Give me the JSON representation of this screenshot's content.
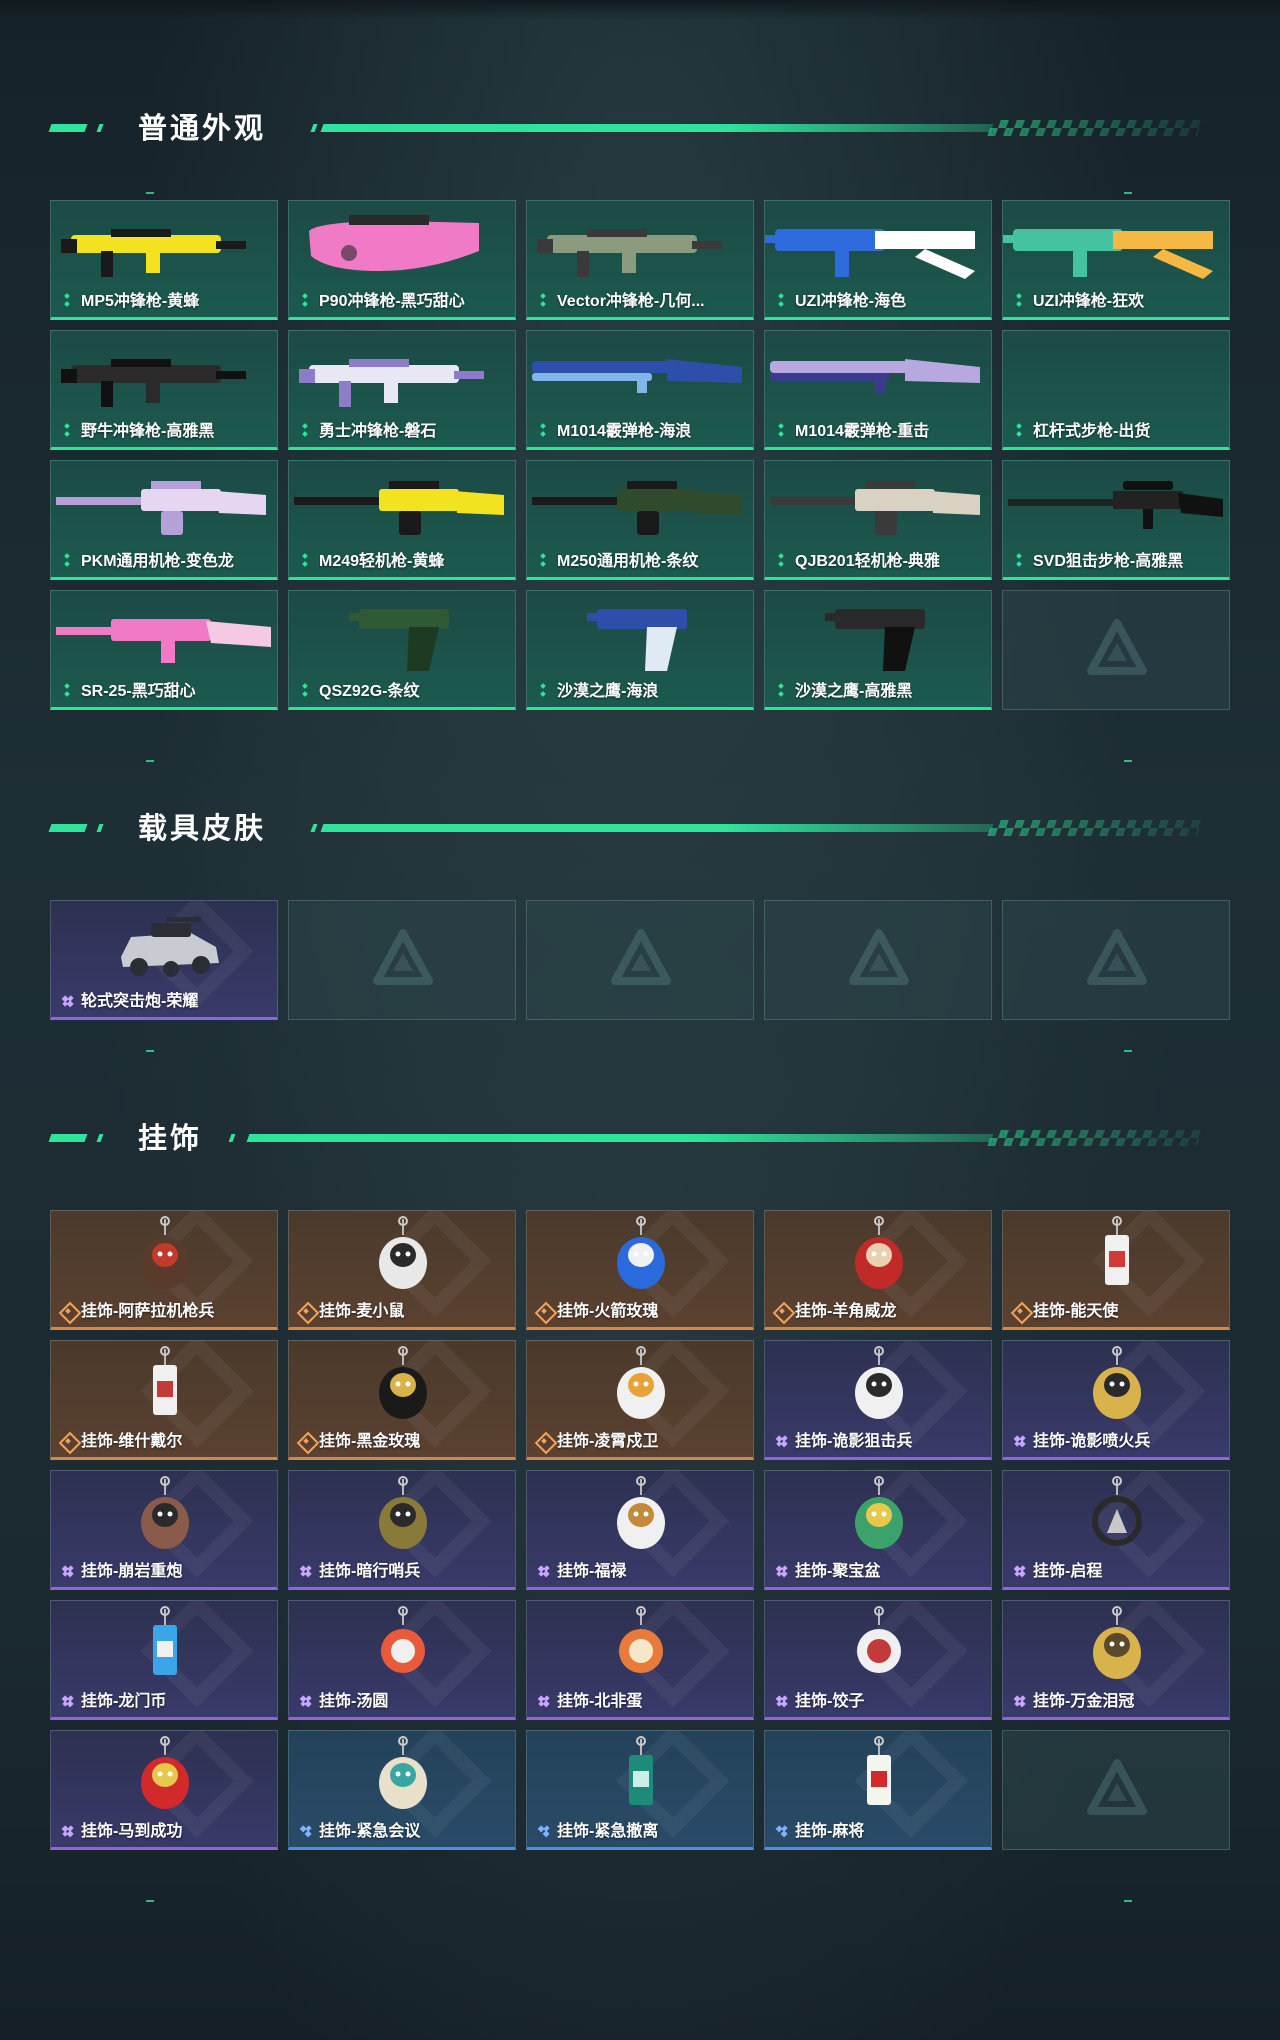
{
  "sections": [
    {
      "title": "普通外观",
      "items": [
        {
          "label": "MP5冲锋枪-黄蜂",
          "rarity": "green",
          "art": "weapon-smg",
          "colors": [
            "#f2e21f",
            "#1a1a1a"
          ]
        },
        {
          "label": "P90冲锋枪-黑巧甜心",
          "rarity": "green",
          "art": "weapon-p90",
          "colors": [
            "#f07ac6",
            "#2a2a2a"
          ]
        },
        {
          "label": "Vector冲锋枪-几何...",
          "rarity": "green",
          "art": "weapon-smg",
          "colors": [
            "#8c9a7e",
            "#3a3a3a"
          ]
        },
        {
          "label": "UZI冲锋枪-海色",
          "rarity": "green",
          "art": "weapon-uzi",
          "colors": [
            "#ffffff",
            "#2e6bdc"
          ]
        },
        {
          "label": "UZI冲锋枪-狂欢",
          "rarity": "green",
          "art": "weapon-uzi",
          "colors": [
            "#f5b943",
            "#45c2a0"
          ]
        },
        {
          "label": "野牛冲锋枪-高雅黑",
          "rarity": "green",
          "art": "weapon-smg",
          "colors": [
            "#2b2b2b",
            "#111111"
          ]
        },
        {
          "label": "勇士冲锋枪-磐石",
          "rarity": "green",
          "art": "weapon-smg",
          "colors": [
            "#e8e8f5",
            "#8e7bc9"
          ]
        },
        {
          "label": "M1014霰弹枪-海浪",
          "rarity": "green",
          "art": "weapon-shotgun",
          "colors": [
            "#2d4fa9",
            "#7fb7ea"
          ]
        },
        {
          "label": "M1014霰弹枪-重击",
          "rarity": "green",
          "art": "weapon-shotgun",
          "colors": [
            "#b7a9e0",
            "#3b3a8c"
          ]
        },
        {
          "label": "杠杆式步枪-出货",
          "rarity": "green",
          "art": "none",
          "colors": [
            "#000000",
            "#000000"
          ]
        },
        {
          "label": "PKM通用机枪-变色龙",
          "rarity": "green",
          "art": "weapon-lmg",
          "colors": [
            "#e6d6f2",
            "#b4a1d8"
          ]
        },
        {
          "label": "M249轻机枪-黄蜂",
          "rarity": "green",
          "art": "weapon-lmg",
          "colors": [
            "#f2e21f",
            "#1a1a1a"
          ]
        },
        {
          "label": "M250通用机枪-条纹",
          "rarity": "green",
          "art": "weapon-lmg",
          "colors": [
            "#2f4a2c",
            "#1a1a1a"
          ]
        },
        {
          "label": "QJB201轻机枪-典雅",
          "rarity": "green",
          "art": "weapon-lmg",
          "colors": [
            "#d9d2c2",
            "#3a3a3a"
          ]
        },
        {
          "label": "SVD狙击步枪-高雅黑",
          "rarity": "green",
          "art": "weapon-sniper",
          "colors": [
            "#222222",
            "#111111"
          ]
        },
        {
          "label": "SR-25-黑巧甜心",
          "rarity": "green",
          "art": "weapon-rifle",
          "colors": [
            "#f07ac6",
            "#f5c8e4"
          ]
        },
        {
          "label": "QSZ92G-条纹",
          "rarity": "green",
          "art": "weapon-pistol",
          "colors": [
            "#2f5a35",
            "#1d3a22"
          ]
        },
        {
          "label": "沙漠之鹰-海浪",
          "rarity": "green",
          "art": "weapon-pistol",
          "colors": [
            "#2d4fa9",
            "#dfeaf5"
          ]
        },
        {
          "label": "沙漠之鹰-高雅黑",
          "rarity": "green",
          "art": "weapon-pistol",
          "colors": [
            "#2a2a2a",
            "#111111"
          ]
        },
        {
          "label": "",
          "rarity": "empty",
          "art": "empty",
          "colors": [
            "#000000",
            "#000000"
          ]
        }
      ]
    },
    {
      "title": "载具皮肤",
      "items": [
        {
          "label": "轮式突击炮-荣耀",
          "rarity": "purple",
          "art": "vehicle",
          "colors": [
            "#c8ccd2",
            "#2a2d35"
          ]
        },
        {
          "label": "",
          "rarity": "empty",
          "art": "empty",
          "colors": [
            "#000000",
            "#000000"
          ]
        },
        {
          "label": "",
          "rarity": "empty",
          "art": "empty",
          "colors": [
            "#000000",
            "#000000"
          ]
        },
        {
          "label": "",
          "rarity": "empty",
          "art": "empty",
          "colors": [
            "#000000",
            "#000000"
          ]
        },
        {
          "label": "",
          "rarity": "empty",
          "art": "empty",
          "colors": [
            "#000000",
            "#000000"
          ]
        }
      ]
    },
    {
      "title": "挂饰",
      "items": [
        {
          "label": "挂饰-阿萨拉机枪兵",
          "rarity": "orange",
          "art": "charm",
          "colors": [
            "#5a3a2a",
            "#c23a2a"
          ]
        },
        {
          "label": "挂饰-麦小鼠",
          "rarity": "orange",
          "art": "charm",
          "colors": [
            "#e8e8e8",
            "#2a2a2a"
          ]
        },
        {
          "label": "挂饰-火箭玫瑰",
          "rarity": "orange",
          "art": "charm",
          "colors": [
            "#2a6adc",
            "#f0f0f0"
          ]
        },
        {
          "label": "挂饰-羊角威龙",
          "rarity": "orange",
          "art": "charm",
          "colors": [
            "#c22a2a",
            "#e8d0b0"
          ]
        },
        {
          "label": "挂饰-能天使",
          "rarity": "orange",
          "art": "charm-tag",
          "colors": [
            "#f0f0f0",
            "#d23a3a"
          ]
        },
        {
          "label": "挂饰-维什戴尔",
          "rarity": "orange",
          "art": "charm-tag",
          "colors": [
            "#f0f0f0",
            "#c23a3a"
          ]
        },
        {
          "label": "挂饰-黑金玫瑰",
          "rarity": "orange",
          "art": "charm",
          "colors": [
            "#1a1a1a",
            "#d8b24a"
          ]
        },
        {
          "label": "挂饰-凌霄戍卫",
          "rarity": "orange",
          "art": "charm",
          "colors": [
            "#f0f0f0",
            "#e8a23a"
          ]
        },
        {
          "label": "挂饰-诡影狙击兵",
          "rarity": "purple",
          "art": "charm",
          "colors": [
            "#f0f0f0",
            "#2a2a2a"
          ]
        },
        {
          "label": "挂饰-诡影喷火兵",
          "rarity": "purple",
          "art": "charm",
          "colors": [
            "#d8b24a",
            "#2a2a2a"
          ]
        },
        {
          "label": "挂饰-崩岩重炮",
          "rarity": "purple",
          "art": "charm",
          "colors": [
            "#8a5a4a",
            "#2a2a2a"
          ]
        },
        {
          "label": "挂饰-暗行哨兵",
          "rarity": "purple",
          "art": "charm",
          "colors": [
            "#8a7a3a",
            "#2a2a2a"
          ]
        },
        {
          "label": "挂饰-福禄",
          "rarity": "purple",
          "art": "charm",
          "colors": [
            "#f0f0f0",
            "#c28a3a"
          ]
        },
        {
          "label": "挂饰-聚宝盆",
          "rarity": "purple",
          "art": "charm",
          "colors": [
            "#3aa26a",
            "#e8c84a"
          ]
        },
        {
          "label": "挂饰-启程",
          "rarity": "purple",
          "art": "charm-ring",
          "colors": [
            "#2a2a2a",
            "#c8c8c8"
          ]
        },
        {
          "label": "挂饰-龙门币",
          "rarity": "purple",
          "art": "charm-tag",
          "colors": [
            "#3aa6e8",
            "#f0f0f0"
          ]
        },
        {
          "label": "挂饰-汤圆",
          "rarity": "purple",
          "art": "charm-round",
          "colors": [
            "#e85a3a",
            "#f0f0f0"
          ]
        },
        {
          "label": "挂饰-北非蛋",
          "rarity": "purple",
          "art": "charm-round",
          "colors": [
            "#e87a3a",
            "#f5e8c8"
          ]
        },
        {
          "label": "挂饰-饺子",
          "rarity": "purple",
          "art": "charm-round",
          "colors": [
            "#f0f0f0",
            "#c23a3a"
          ]
        },
        {
          "label": "挂饰-万金泪冠",
          "rarity": "purple",
          "art": "charm",
          "colors": [
            "#d8b24a",
            "#5a4a2a"
          ]
        },
        {
          "label": "挂饰-马到成功",
          "rarity": "purple",
          "art": "charm",
          "colors": [
            "#d22a2a",
            "#e8c84a"
          ]
        },
        {
          "label": "挂饰-紧急会议",
          "rarity": "blue",
          "art": "charm",
          "colors": [
            "#e8e0c8",
            "#3aa6a2"
          ]
        },
        {
          "label": "挂饰-紧急撤离",
          "rarity": "blue",
          "art": "charm-tag",
          "colors": [
            "#1e8a7a",
            "#c8f0e8"
          ]
        },
        {
          "label": "挂饰-麻将",
          "rarity": "blue",
          "art": "charm-tag",
          "colors": [
            "#f5f5f0",
            "#d22a2a"
          ]
        },
        {
          "label": "",
          "rarity": "empty",
          "art": "empty",
          "colors": [
            "#000000",
            "#000000"
          ]
        }
      ]
    }
  ],
  "colors": {
    "accent": "#2fe39a",
    "green_rarity": "#2fe39a",
    "purple_rarity": "#8e64e0",
    "orange_rarity": "#d5883f",
    "blue_rarity": "#4d8fe0"
  }
}
